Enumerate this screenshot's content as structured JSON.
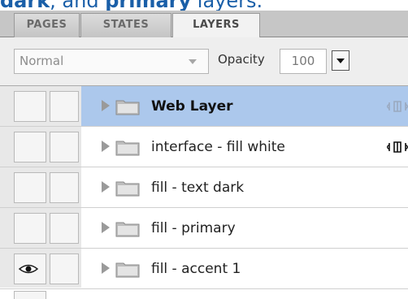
{
  "caption": {
    "part1": "dark",
    "part2": ", and ",
    "part3": "primary",
    "part4": " layers."
  },
  "tabs": [
    {
      "label": "PAGES",
      "active": false
    },
    {
      "label": "STATES",
      "active": false
    },
    {
      "label": "LAYERS",
      "active": true
    }
  ],
  "options": {
    "blend_mode": "Normal",
    "opacity_label": "Opacity",
    "opacity_value": "100"
  },
  "layers": [
    {
      "name": "Web Layer",
      "selected": true,
      "visible": false,
      "link_icon": "link-icon-faded"
    },
    {
      "name": "interface - fill white",
      "selected": false,
      "visible": false,
      "link_icon": "link-icon"
    },
    {
      "name": "fill - text dark",
      "selected": false,
      "visible": false,
      "link_icon": ""
    },
    {
      "name": "fill - primary",
      "selected": false,
      "visible": false,
      "link_icon": ""
    },
    {
      "name": "fill - accent 1",
      "selected": false,
      "visible": true,
      "link_icon": ""
    }
  ],
  "colors": {
    "selected_row": "#acc8ec",
    "caption_text": "#1a5fa8"
  }
}
